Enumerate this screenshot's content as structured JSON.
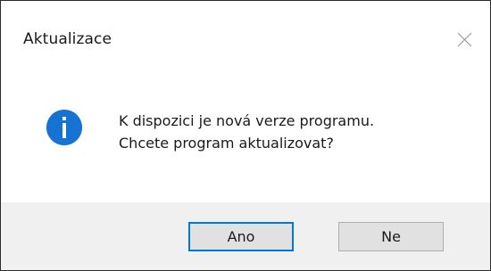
{
  "dialog": {
    "title": "Aktualizace",
    "message_line1": "K dispozici je nová verze programu.",
    "message_line2": "Chcete program aktualizovat?",
    "icon": "info-icon",
    "buttons": {
      "yes_label": "Ano",
      "no_label": "Ne"
    }
  },
  "colors": {
    "accent": "#0078d7",
    "footer_bg": "#f0f0f0",
    "button_bg": "#e1e1e1"
  }
}
